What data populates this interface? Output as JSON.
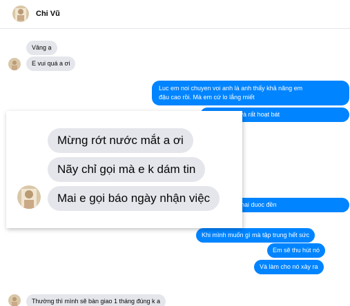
{
  "contact": {
    "name": "Chi Vũ",
    "avatar_icon": "profile-photo-icon"
  },
  "colors": {
    "outgoing_bubble": "#0084ff",
    "incoming_bubble": "#e4e6eb",
    "background": "#ffffff"
  },
  "messages": [
    {
      "dir": "in",
      "text": "Vâng ạ"
    },
    {
      "dir": "in",
      "text": "E vui quá a ơi"
    },
    {
      "dir": "out",
      "text": "Luc em noi chuyen voi anh là anh thấy khả năng em"
    },
    {
      "dir": "out",
      "text": "đậu cao rồi. Mà em cứ lo lắng miết"
    },
    {
      "dir": "out",
      "text": "có năng lực và rất hoạt bát"
    },
    {
      "dir": "out",
      "text": "luc cua em phai duoc đền"
    },
    {
      "dir": "out",
      "text": "Khi mình muốn gì mà tập trung hết sức"
    },
    {
      "dir": "out",
      "text": "Em sẽ thu hút nó"
    },
    {
      "dir": "out",
      "text": "Và làm cho nó xảy ra"
    },
    {
      "dir": "in",
      "text": "Thường thì mình sẽ bàn giao 1 tháng đúng k a"
    }
  ],
  "zoomed": [
    {
      "text": "Mừng rớt nước mắt a ơi"
    },
    {
      "text": "Nãy chỉ gọi mà e k dám tin"
    },
    {
      "text": "Mai e gọi báo ngày nhận việc"
    }
  ]
}
